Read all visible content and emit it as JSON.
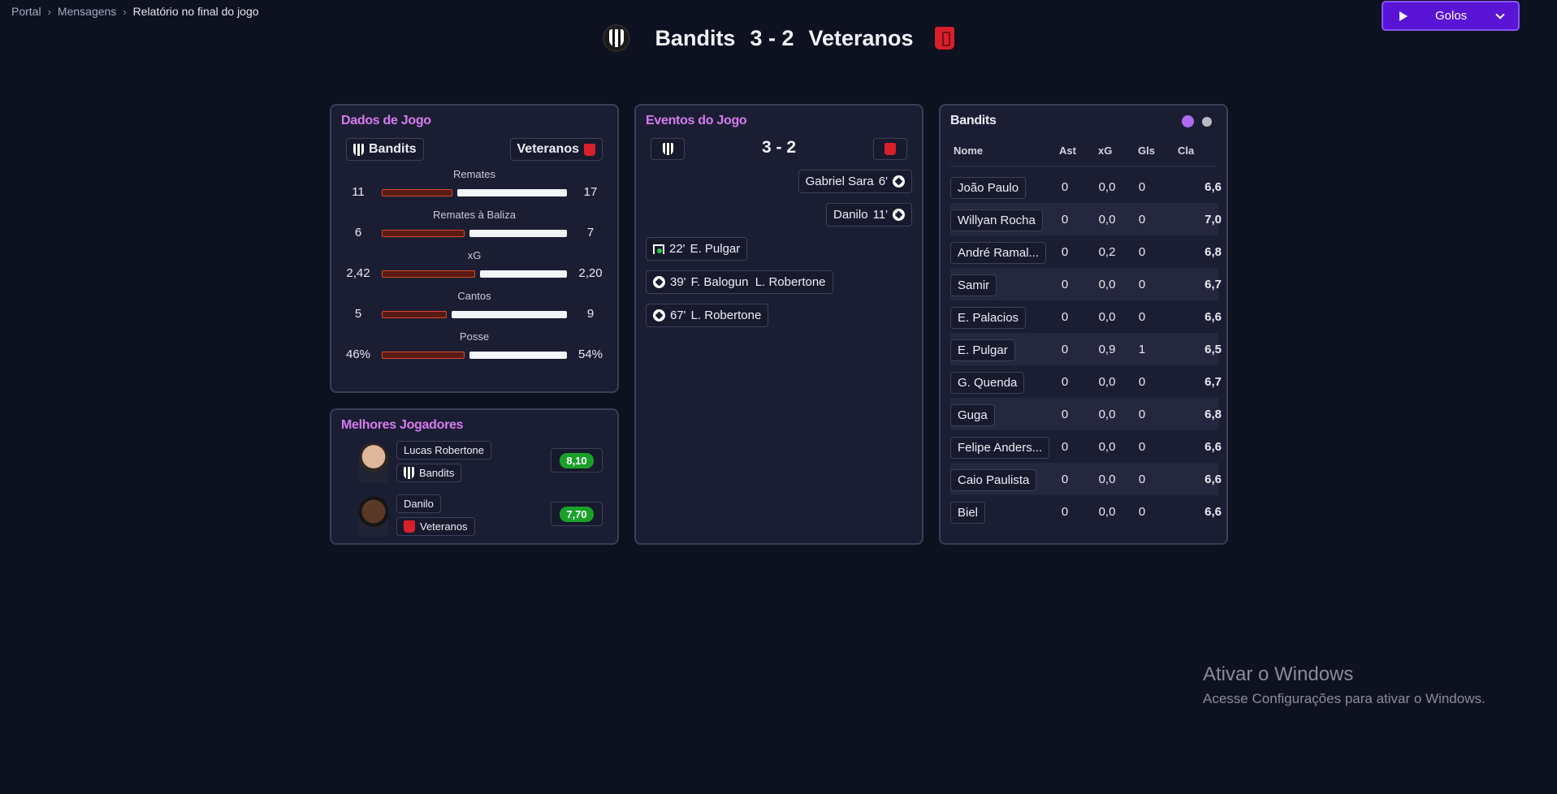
{
  "breadcrumb": {
    "items": [
      "Portal",
      "Mensagens",
      "Relatório no final do jogo"
    ],
    "separator": ">"
  },
  "action_button": {
    "label": "Golos"
  },
  "match": {
    "home_team": "Bandits",
    "away_team": "Veteranos",
    "score": "3 - 2"
  },
  "dados": {
    "title": "Dados de Jogo",
    "home_team": "Bandits",
    "away_team": "Veteranos",
    "stats": [
      {
        "name": "Remates",
        "home": "11",
        "away": "17",
        "home_share": 0.39
      },
      {
        "name": "Remates à Baliza",
        "home": "6",
        "away": "7",
        "home_share": 0.46
      },
      {
        "name": "xG",
        "home": "2,42",
        "away": "2,20",
        "home_share": 0.52
      },
      {
        "name": "Cantos",
        "home": "5",
        "away": "9",
        "home_share": 0.36
      },
      {
        "name": "Posse",
        "home": "46%",
        "away": "54%",
        "home_share": 0.46
      }
    ]
  },
  "melhores": {
    "title": "Melhores Jogadores",
    "players": [
      {
        "name": "Lucas Robertone",
        "team": "Bandits",
        "rating": "8,10"
      },
      {
        "name": "Danilo",
        "team": "Veteranos",
        "rating": "7,70"
      }
    ]
  },
  "eventos": {
    "title": "Eventos do Jogo",
    "score": "3 - 2",
    "events": [
      {
        "side": "away",
        "minute": "6'",
        "text": "Gabriel Sara",
        "icon": "ball-icon"
      },
      {
        "side": "away",
        "minute": "11'",
        "text": "Danilo",
        "icon": "ball-icon"
      },
      {
        "side": "home",
        "minute": "22'",
        "text": "E. Pulgar",
        "icon": "penalty-goal-icon"
      },
      {
        "side": "home",
        "minute": "39'",
        "text": "F. Balogun  L. Robertone",
        "icon": "ball-icon"
      },
      {
        "side": "home",
        "minute": "67'",
        "text": "L. Robertone",
        "icon": "ball-icon"
      }
    ]
  },
  "tabela": {
    "title": "Bandits",
    "headers": {
      "nome": "Nome",
      "ast": "Ast",
      "xg": "xG",
      "gls": "Gls",
      "cla": "Cla"
    },
    "rows": [
      {
        "nome": "João Paulo",
        "ast": "0",
        "xg": "0,0",
        "gls": "0",
        "cla": "6,6"
      },
      {
        "nome": "Willyan Rocha",
        "ast": "0",
        "xg": "0,0",
        "gls": "0",
        "cla": "7,0"
      },
      {
        "nome": "André Ramal...",
        "ast": "0",
        "xg": "0,2",
        "gls": "0",
        "cla": "6,8"
      },
      {
        "nome": "Samir",
        "ast": "0",
        "xg": "0,0",
        "gls": "0",
        "cla": "6,7"
      },
      {
        "nome": "E. Palacios",
        "ast": "0",
        "xg": "0,0",
        "gls": "0",
        "cla": "6,6"
      },
      {
        "nome": "E. Pulgar",
        "ast": "0",
        "xg": "0,9",
        "gls": "1",
        "cla": "6,5"
      },
      {
        "nome": "G. Quenda",
        "ast": "0",
        "xg": "0,0",
        "gls": "0",
        "cla": "6,7"
      },
      {
        "nome": "Guga",
        "ast": "0",
        "xg": "0,0",
        "gls": "0",
        "cla": "6,8"
      },
      {
        "nome": "Felipe Anders...",
        "ast": "0",
        "xg": "0,0",
        "gls": "0",
        "cla": "6,6"
      },
      {
        "nome": "Caio Paulista",
        "ast": "0",
        "xg": "0,0",
        "gls": "0",
        "cla": "6,6"
      },
      {
        "nome": "Biel",
        "ast": "0",
        "xg": "0,0",
        "gls": "0",
        "cla": "6,6"
      }
    ]
  },
  "watermark": {
    "title": "Ativar o Windows",
    "subtitle": "Acesse Configurações para ativar o Windows."
  },
  "colors": {
    "accent": "#5a14d6",
    "title_pink": "#d67bf0",
    "home_bar": "#d84a2e",
    "away_bar": "#f4f5f8",
    "rating_green": "#19a12a"
  }
}
